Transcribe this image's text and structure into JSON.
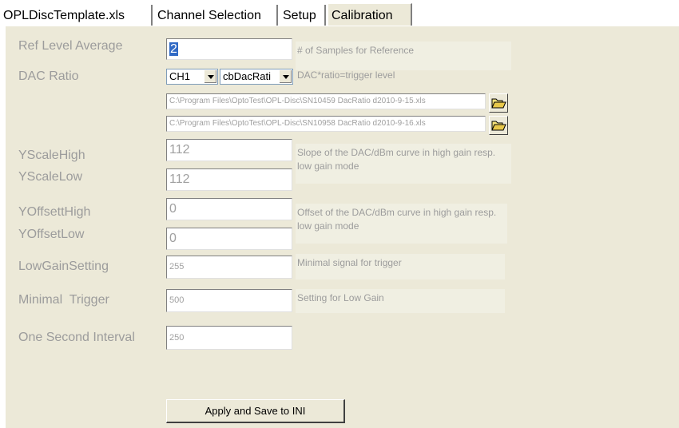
{
  "tabs": [
    {
      "label": "OPLDiscTemplate.xls"
    },
    {
      "label": "Channel Selection"
    },
    {
      "label": "Setup"
    },
    {
      "label": "Calibration"
    }
  ],
  "calibration": {
    "ref_level_average": {
      "label": "Ref Level Average",
      "value": "2",
      "desc": "# of Samples for Reference"
    },
    "dac_ratio": {
      "label": "DAC Ratio",
      "channel": "CH1",
      "ratio_combo": "cbDacRati",
      "desc": "DAC*ratio=trigger level",
      "path1": "C:\\Program Files\\OptoTest\\OPL-Disc\\SN10459 DacRatio d2010-9-15.xls",
      "path2": "C:\\Program Files\\OptoTest\\OPL-Disc\\SN10958 DacRatio d2010-9-16.xls"
    },
    "yscale_high": {
      "label": "YScaleHigh",
      "value": "112"
    },
    "yscale_low": {
      "label": "YScaleLow",
      "value": "112"
    },
    "yscale_desc": "Slope of the DAC/dBm curve in high gain resp. low gain mode",
    "yoffset_high": {
      "label": "YOffsettHigh",
      "value": "0"
    },
    "yoffset_low": {
      "label": "YOffsetLow",
      "value": "0"
    },
    "yoffset_desc": "Offset of the DAC/dBm curve in high gain resp. low gain mode",
    "low_gain_setting": {
      "label": "LowGainSetting",
      "value": "255",
      "desc": "Minimal signal for trigger"
    },
    "minimal_trigger": {
      "label": "Minimal  Trigger",
      "value": "500",
      "desc": "Setting for Low Gain"
    },
    "one_second_interval": {
      "label": "One Second Interval",
      "value": "250"
    },
    "apply_button": "Apply and Save to INI"
  }
}
